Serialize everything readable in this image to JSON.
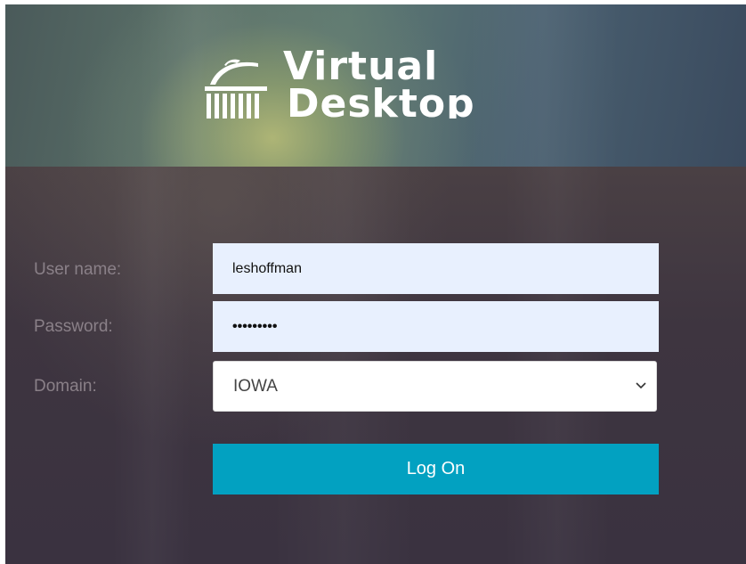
{
  "header": {
    "logo_icon": "capitol-building-icon",
    "logo_line1": "Virtual",
    "logo_line2": "Desktop"
  },
  "form": {
    "username": {
      "label": "User name:",
      "value": "leshoffman"
    },
    "password": {
      "label": "Password:",
      "masked_value": "•••••••••"
    },
    "domain": {
      "label": "Domain:",
      "selected": "IOWA",
      "icon": "chevron-down-icon"
    },
    "logon_label": "Log On"
  },
  "colors": {
    "button": "#02a1c1",
    "field_background": "#e8f0fe",
    "body_background": "#3d3541",
    "label_text": "#8a8088"
  }
}
